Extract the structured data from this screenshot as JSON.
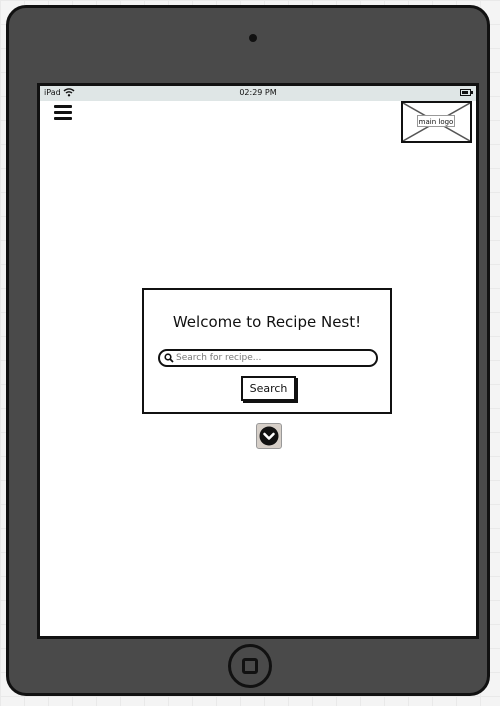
{
  "status_bar": {
    "carrier": "iPad",
    "time": "02:29 PM"
  },
  "header": {
    "menu_icon": "hamburger-menu-icon",
    "logo_label": "main logo"
  },
  "welcome_panel": {
    "title": "Welcome to Recipe Nest!",
    "search_placeholder": "Search for recipe...",
    "search_button_label": "Search"
  },
  "scroll_button": {
    "icon": "chevron-down-circle-icon"
  },
  "colors": {
    "device_body": "#4a4a4a",
    "status_bar": "#dfe6e6",
    "scroll_button_bg": "#d6cfc8"
  }
}
